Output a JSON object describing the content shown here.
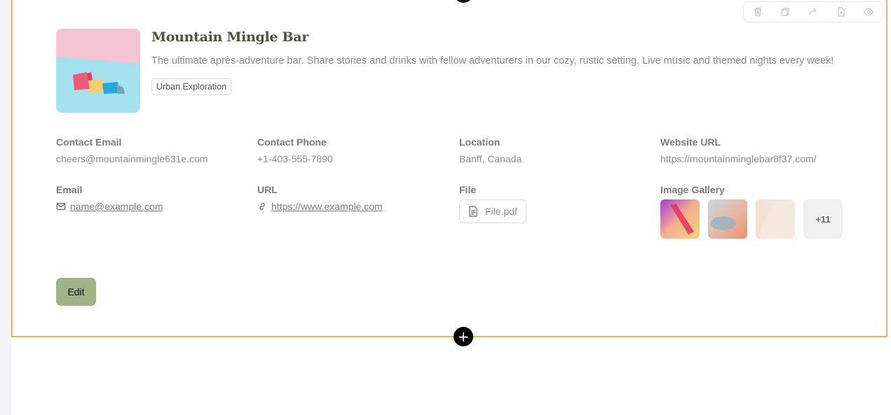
{
  "venue": {
    "name": "Mountain Mingle Bar",
    "description": "The ultimate après-adventure bar. Share stories and drinks with fellow adventurers in our cozy, rustic setting. Live music and themed nights every week!",
    "tag": "Urban Exploration"
  },
  "details": {
    "contact_email": {
      "label": "Contact Email",
      "value": "cheers@mountainmingle631e.com"
    },
    "contact_phone": {
      "label": "Contact Phone",
      "value": "+1-403-555-7890"
    },
    "location": {
      "label": "Location",
      "value": "Banff, Canada"
    },
    "website": {
      "label": "Website URL",
      "value": "https://mountainminglebar8f37.com/"
    },
    "email": {
      "label": "Email",
      "value": "name@example.com"
    },
    "url": {
      "label": "URL",
      "value": "https://www.example.com"
    },
    "file": {
      "label": "File",
      "value": "File.pdf"
    },
    "gallery": {
      "label": "Image Gallery",
      "more": "+11"
    }
  },
  "actions": {
    "edit": "Edit"
  },
  "toolbar": {
    "icons": [
      "trash-icon",
      "duplicate-icon",
      "forward-icon",
      "file-export-icon",
      "eye-icon"
    ]
  },
  "colors": {
    "accent_border": "#e8b15c",
    "edit_button": "#9fb386",
    "title": "#4d5340"
  }
}
